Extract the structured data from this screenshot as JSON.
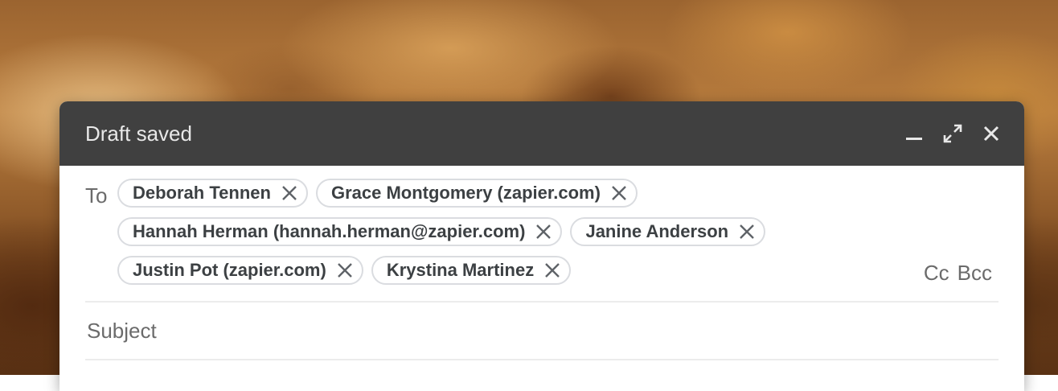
{
  "compose": {
    "title": "Draft saved",
    "controls": [
      {
        "icon": "minimize-icon"
      },
      {
        "icon": "expand-icon"
      },
      {
        "icon": "close-icon"
      }
    ]
  },
  "recipients": {
    "to_label": "To",
    "rows": [
      [
        {
          "name": "Deborah Tennen"
        },
        {
          "name": "Grace Montgomery (zapier.com)"
        }
      ],
      [
        {
          "name": "Hannah Herman (hannah.herman@zapier.com)"
        },
        {
          "name": "Janine Anderson"
        }
      ],
      [
        {
          "name": "Justin Pot (zapier.com)"
        },
        {
          "name": "Krystina Martinez"
        }
      ]
    ],
    "cc_label": "Cc",
    "bcc_label": "Bcc"
  },
  "subject": {
    "placeholder": "Subject",
    "value": ""
  },
  "colors": {
    "titlebar": "#404040",
    "chip_border": "#dadce0",
    "chip_text": "#3c4043",
    "muted_text": "#6b6b6b"
  }
}
